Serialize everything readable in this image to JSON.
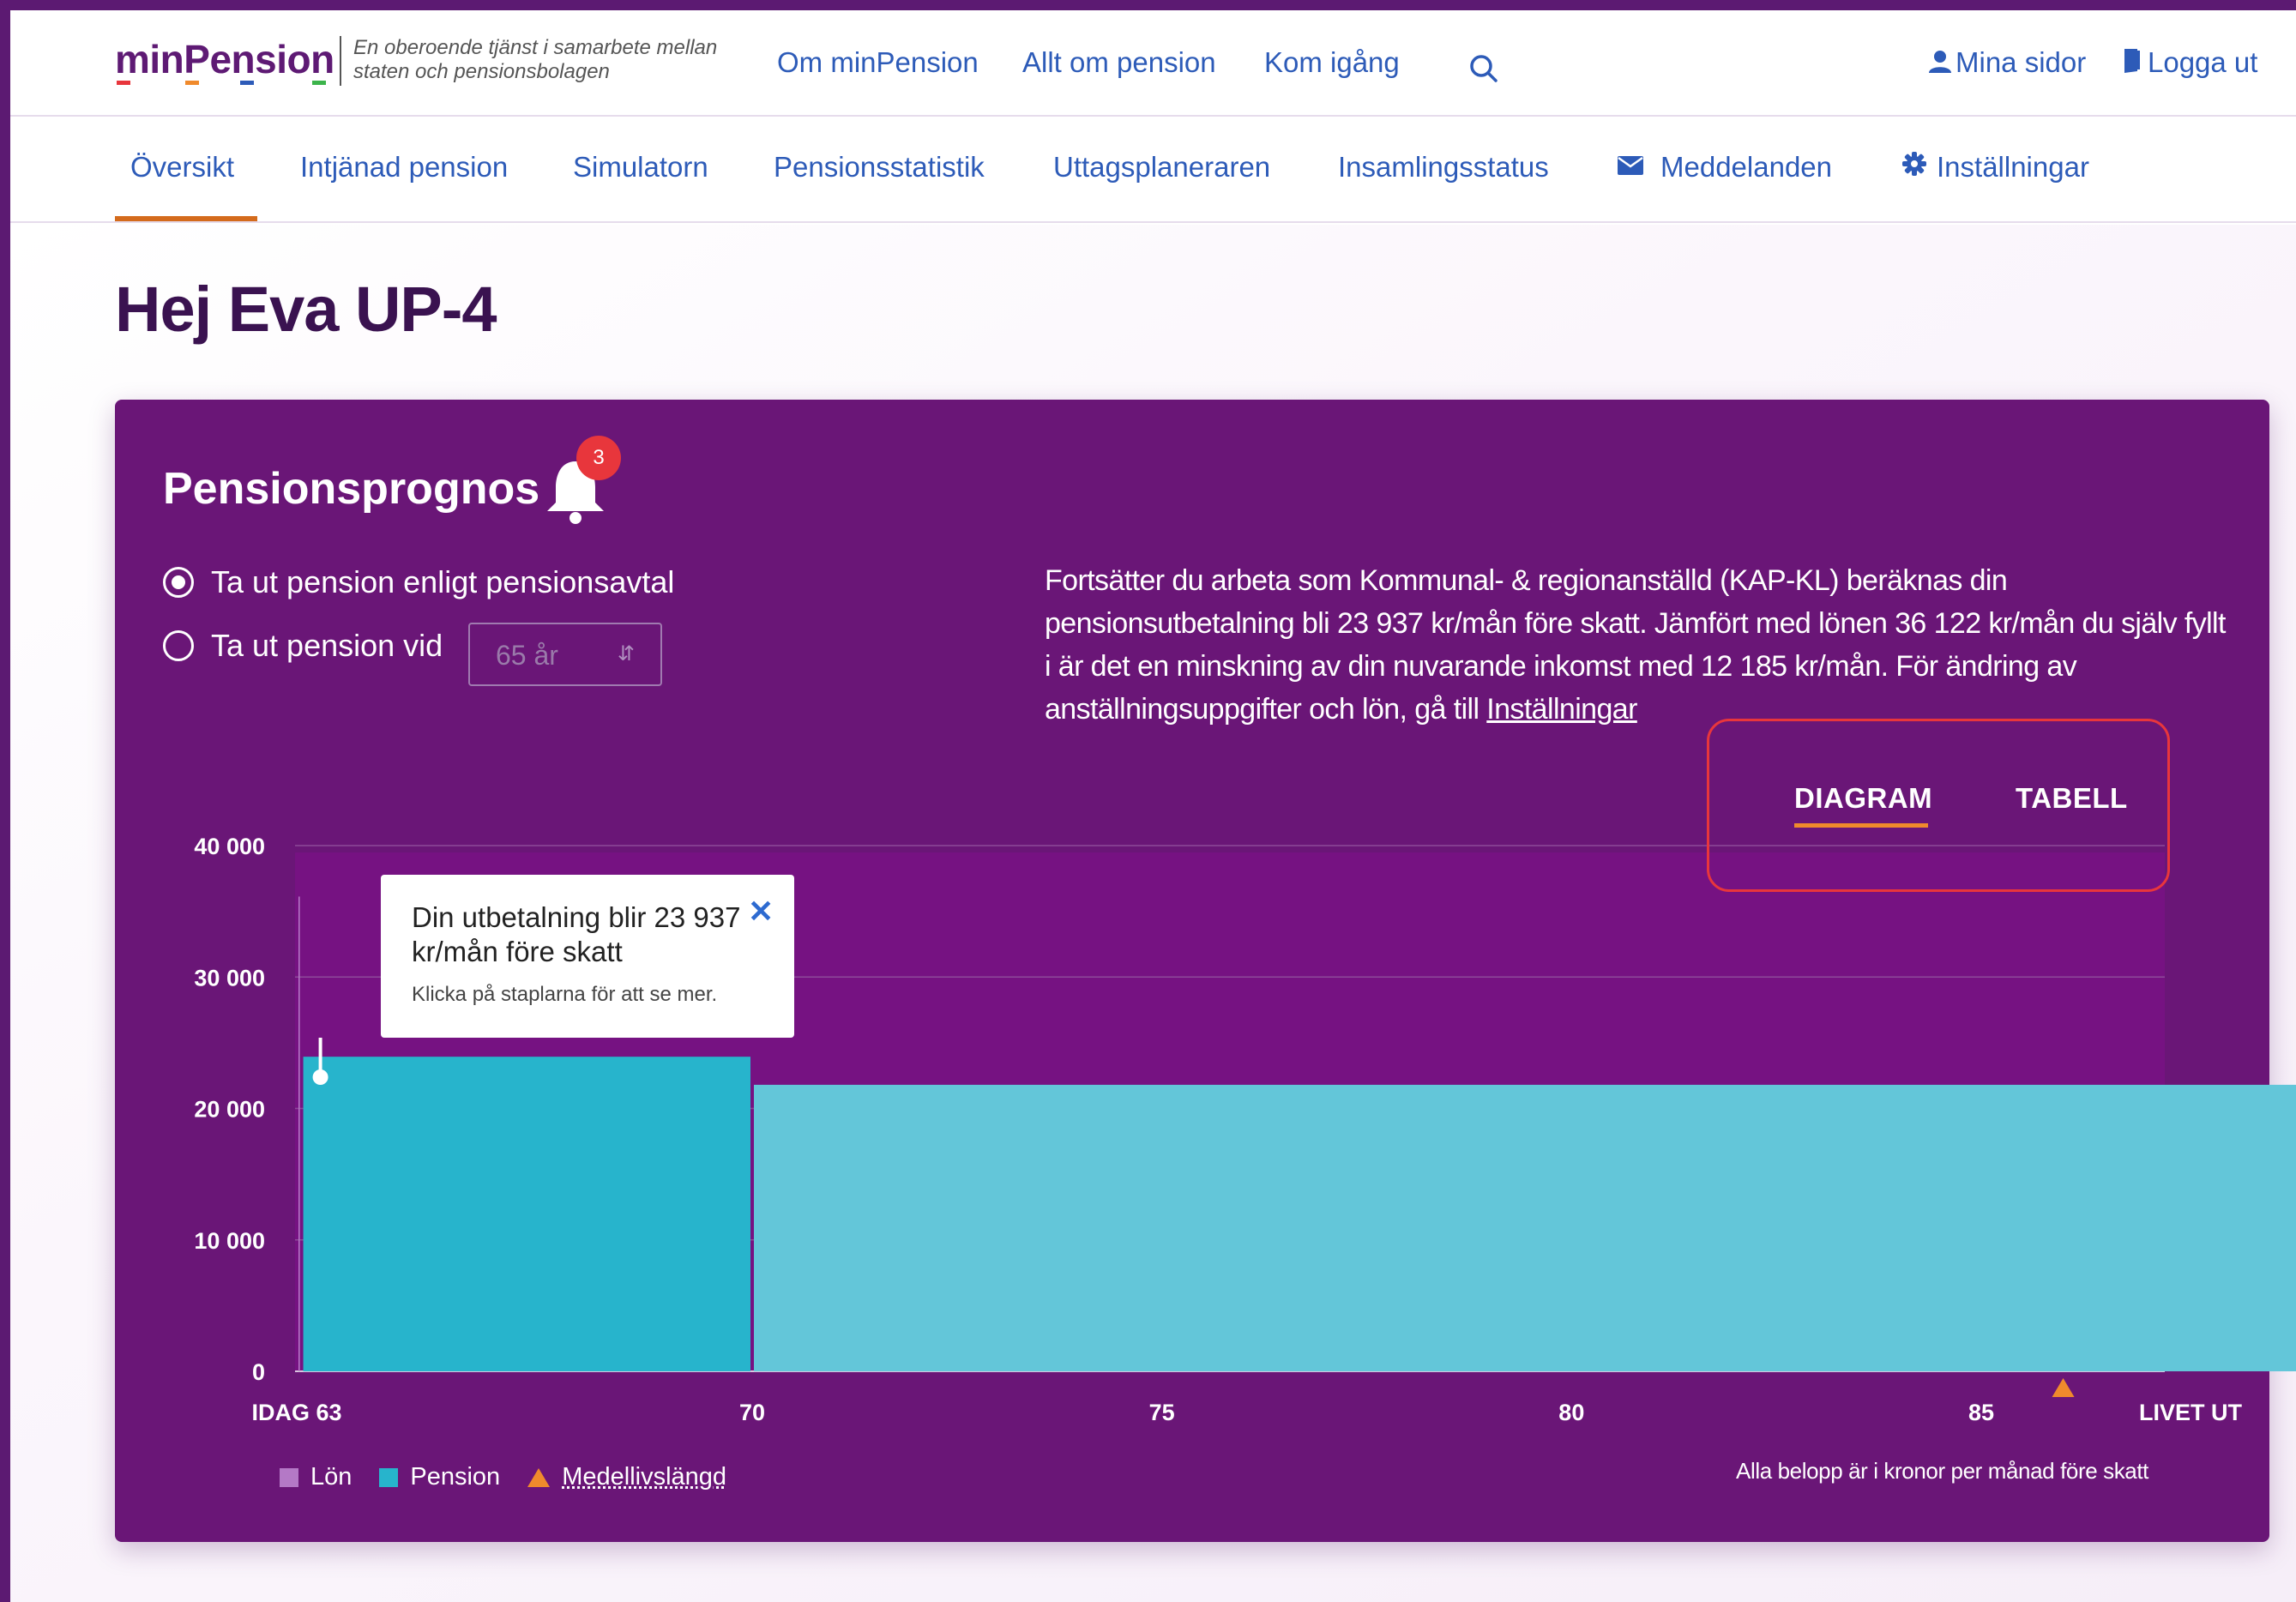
{
  "header": {
    "logo": "minPension",
    "tagline": "En oberoende tjänst i samarbete mellan staten och pensionsbolagen",
    "nav": [
      "Om minPension",
      "Allt om pension",
      "Kom igång"
    ],
    "mina_sidor": "Mina sidor",
    "logga_ut": "Logga ut"
  },
  "subnav": {
    "tabs": [
      "Översikt",
      "Intjänad pension",
      "Simulatorn",
      "Pensionsstatistik",
      "Uttagsplaneraren",
      "Insamlingsstatus",
      "Meddelanden",
      "Inställningar"
    ],
    "active": "Översikt"
  },
  "greeting": "Hej Eva UP-4",
  "card": {
    "title": "Pensionsprognos",
    "notification_count": "3",
    "radio_option_1": "Ta ut pension enligt pensionsavtal",
    "radio_option_2": "Ta ut pension vid",
    "age_select_value": "65 år",
    "description": "Fortsätter du arbeta som Kommunal- & regionanställd (KAP-KL) beräknas din pensionsutbetalning bli 23 937 kr/mån före skatt. Jämfört med lönen 36 122 kr/mån du själv fyllt i är det en minskning av din nuvarande inkomst med 12 185 kr/mån. För ändring av anställningsuppgifter och lön, gå till ",
    "description_link": "Inställningar",
    "view_tabs": {
      "diagram": "DIAGRAM",
      "tabell": "TABELL",
      "active": "DIAGRAM"
    },
    "tooltip": {
      "title": "Din utbetalning blir 23 937 kr/mån före skatt",
      "hint": "Klicka på staplarna för att se mer."
    },
    "legend": {
      "lon": "Lön",
      "pension": "Pension",
      "medellivslangd": "Medellivslängd"
    },
    "footnote": "Alla belopp är i kronor per månad före skatt"
  },
  "colors": {
    "brand_purple": "#6a1677",
    "lon": "#b479c6",
    "pension_1": "#27b4cc",
    "pension_2": "#63c6d9",
    "accent_orange": "#f08a2c",
    "link_blue": "#2d5bb8",
    "badge_red": "#e8363c"
  },
  "chart_data": {
    "type": "bar",
    "x_tick_labels": [
      "IDAG 63",
      "70",
      "75",
      "80",
      "85",
      "LIVET UT"
    ],
    "x_tick_values": [
      63,
      70,
      75,
      80,
      85
    ],
    "y_ticks": [
      0,
      10000,
      20000,
      30000,
      40000
    ],
    "y_tick_labels": [
      "0",
      "10 000",
      "20 000",
      "30 000",
      "40 000"
    ],
    "ylim": [
      0,
      40000
    ],
    "xlim": [
      63,
      90.5
    ],
    "series": [
      {
        "name": "Lön",
        "segments": [
          {
            "from": 63,
            "to": 64.5,
            "value": 36122
          }
        ]
      },
      {
        "name": "Pension",
        "segments": [
          {
            "from": 64.5,
            "to": 70,
            "value": 23937
          },
          {
            "from": 70,
            "to": 89.3,
            "value": 21800
          }
        ]
      }
    ],
    "medellivslangd_x": 86
  }
}
